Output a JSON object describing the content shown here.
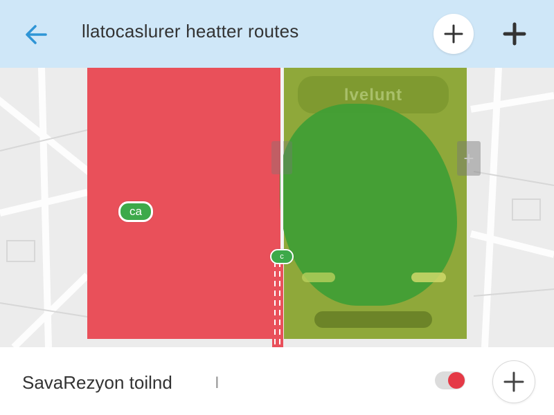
{
  "header": {
    "title": "llatocaslurer heatter routes",
    "back_icon": "arrow-left-icon",
    "add_icon": "plus-icon",
    "accent_color": "#2f95d6",
    "background_color": "#cfe7f8"
  },
  "map": {
    "zones": {
      "red_color": "#e9505a",
      "olive_color": "#8fa83a",
      "blob_color": "#3f9e35"
    },
    "olive_card_label": "lvelunt",
    "markers": {
      "primary_label": "ca",
      "secondary_label": "c"
    },
    "edge_handle_icon": "plus-icon"
  },
  "bottom_bar": {
    "label": "SavaRezyon toilnd",
    "cursor": "I",
    "toggle_on": true,
    "toggle_color": "#e53946",
    "add_icon": "plus-icon"
  }
}
